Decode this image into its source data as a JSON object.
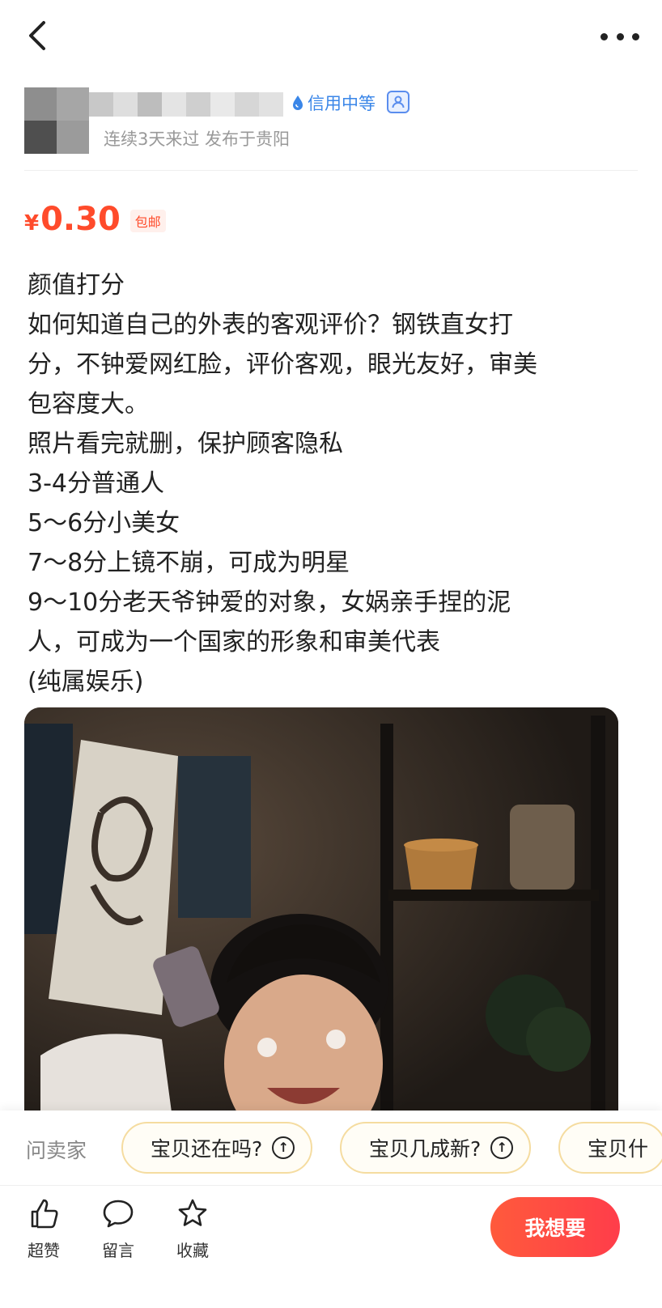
{
  "nav": {
    "back_icon": "chevron-left-icon",
    "more_icon": "more-dots-icon"
  },
  "seller": {
    "credit_label": "信用中等",
    "subtitle": "连续3天来过 发布于贵阳"
  },
  "price": {
    "currency": "¥",
    "amount": "0.30",
    "shipping_tag": "包邮"
  },
  "description": {
    "lines": [
      "颜值打分",
      "如何知道自己的外表的客观评价？钢铁直女打",
      "分，不钟爱网红脸，评价客观，眼光友好，审美",
      "包容度大。",
      "照片看完就删，保护顾客隐私",
      "3-4分普通人",
      "5～6分小美女",
      "7～8分上镜不崩，可成为明星",
      "9～10分老天爷钟爱的对象，女娲亲手捏的泥",
      "人，可成为一个国家的形象和审美代表",
      "(纯属娱乐)"
    ]
  },
  "ask_bar": {
    "label": "问卖家",
    "chips": [
      "宝贝还在吗?",
      "宝贝几成新?",
      "宝贝什"
    ]
  },
  "bottom_bar": {
    "actions": [
      {
        "label": "超赞",
        "icon": "thumbs-up-icon"
      },
      {
        "label": "留言",
        "icon": "comment-icon"
      },
      {
        "label": "收藏",
        "icon": "star-icon"
      }
    ],
    "primary_button": "我想要"
  },
  "colors": {
    "accent": "#ff4b2b",
    "credit_blue": "#3a86e8",
    "chip_border": "#f5dca0"
  }
}
